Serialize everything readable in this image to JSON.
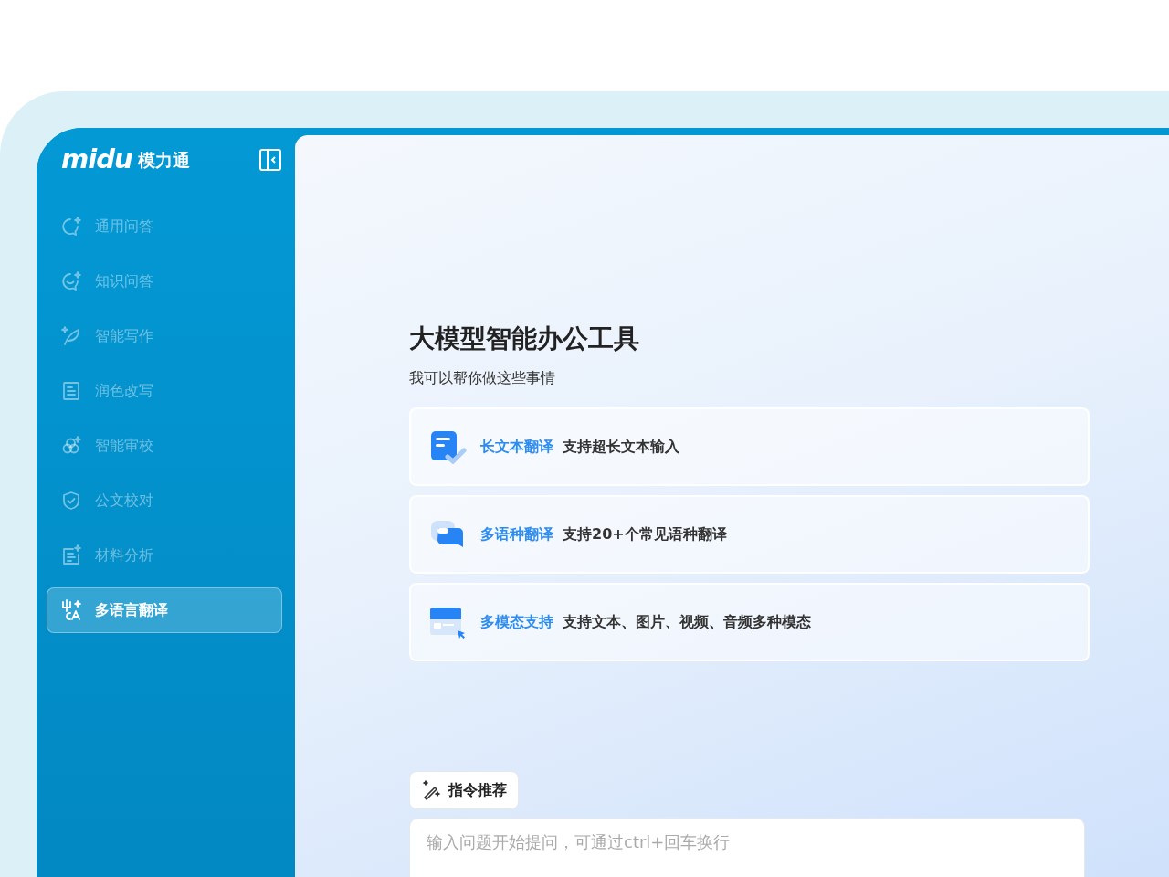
{
  "logo": {
    "brand": "midu",
    "name": "模力通"
  },
  "nav": [
    {
      "label": "通用问答",
      "selected": false
    },
    {
      "label": "知识问答",
      "selected": false
    },
    {
      "label": "智能写作",
      "selected": false
    },
    {
      "label": "润色改写",
      "selected": false
    },
    {
      "label": "智能审校",
      "selected": false
    },
    {
      "label": "公文校对",
      "selected": false
    },
    {
      "label": "材料分析",
      "selected": false
    },
    {
      "label": "多语言翻译",
      "selected": true
    }
  ],
  "main": {
    "title": "大模型智能办公工具",
    "subtitle": "我可以帮你做这些事情",
    "features": [
      {
        "title": "长文本翻译",
        "description": "支持超长文本输入"
      },
      {
        "title": "多语种翻译",
        "description": "支持20+个常见语种翻译"
      },
      {
        "title": "多模态支持",
        "description": "支持文本、图片、视频、音频多种模态"
      }
    ],
    "prompt_button": "指令推荐",
    "input": {
      "placeholder": "输入问题开始提问，可通过ctrl+回车换行"
    }
  }
}
